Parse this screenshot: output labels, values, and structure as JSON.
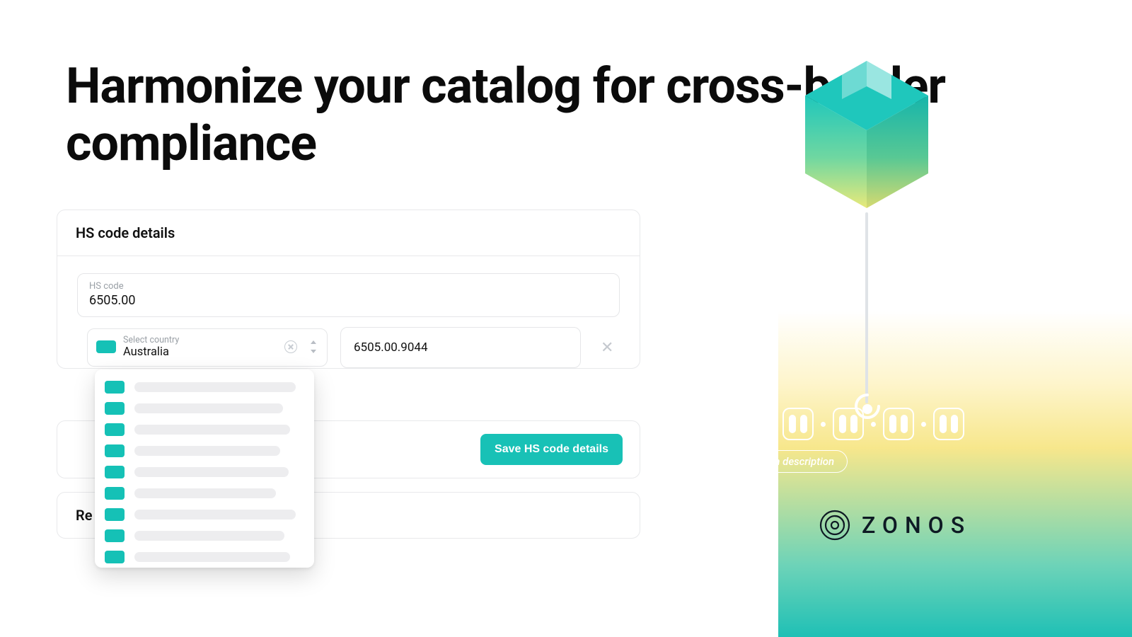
{
  "headline": "Harmonize your catalog for cross-border compliance",
  "card": {
    "title": "HS code details",
    "hs_code_label": "HS code",
    "hs_code_value": "6505.00",
    "country_label": "Select country",
    "country_value": "Australia",
    "subcode_value": "6505.00.9044"
  },
  "save_button": "Save HS code details",
  "truncated_card_prefix": "Re",
  "dropdown_bar_widths": [
    228,
    210,
    220,
    206,
    218,
    200,
    228,
    212,
    220
  ],
  "illustration": {
    "chip_label": "Item description"
  },
  "brand": "ZONOS",
  "colors": {
    "teal": "#18c1b6"
  }
}
